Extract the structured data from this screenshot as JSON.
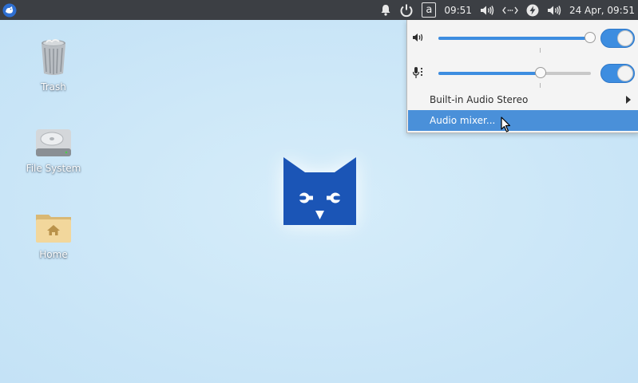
{
  "panel": {
    "app_menu_icon": "xfce-mouse-icon",
    "notification_icon": "bell-icon",
    "power_icon": "power-icon",
    "keyboard_layout": "a",
    "time_short": "09:51",
    "volume_icon": "speaker-icon",
    "network_icon": "network-icon",
    "power_manager_icon": "lightning-icon",
    "volume2_icon": "speaker-icon",
    "datetime": "24 Apr, 09:51",
    "colors": {
      "background": "#3c3f44",
      "text": "#e8e8e8"
    }
  },
  "desktop": {
    "icons": [
      {
        "name": "trash",
        "label": "Trash"
      },
      {
        "name": "file-system",
        "label": "File System"
      },
      {
        "name": "home",
        "label": "Home"
      }
    ],
    "background_color": "#cce7f8",
    "logo_color": "#1b55b6"
  },
  "audio_popup": {
    "output": {
      "icon": "speaker-icon",
      "volume_fraction": 1.0,
      "enabled": true
    },
    "input": {
      "icon": "microphone-icon",
      "volume_fraction": 0.67,
      "enabled": true
    },
    "device_label": "Built-in Audio Stereo",
    "mixer_label": "Audio mixer...",
    "accent_color": "#3d8de0",
    "highlight_color": "#4a90d9"
  }
}
